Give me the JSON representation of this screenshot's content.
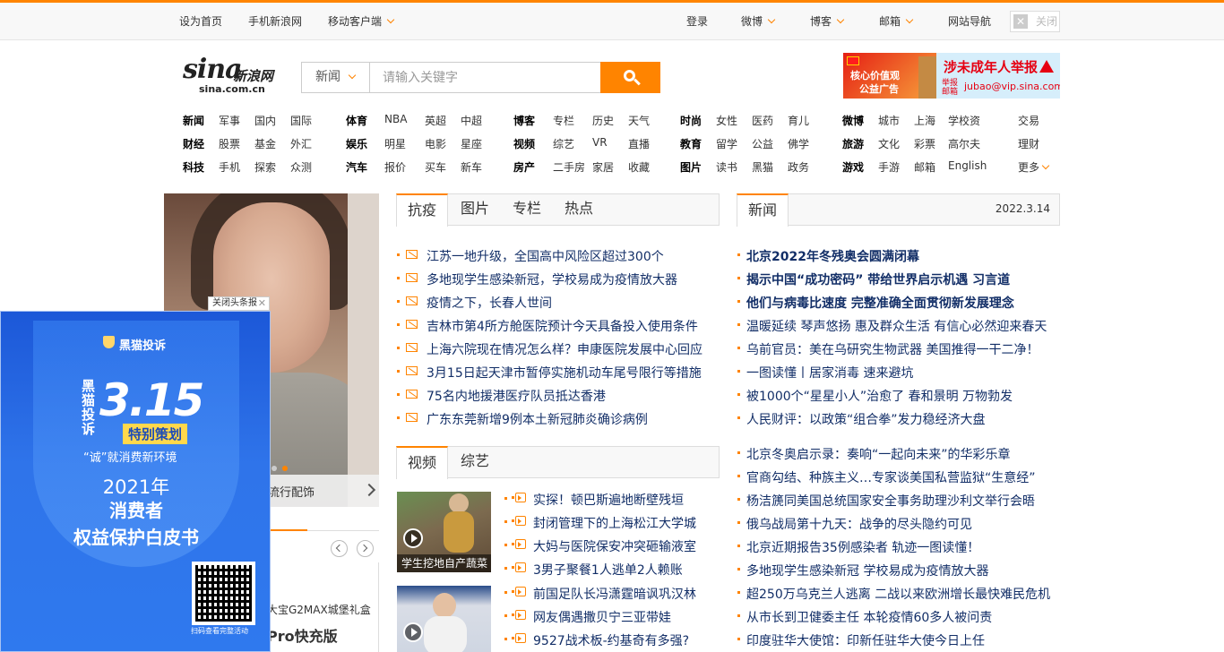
{
  "topbar": {
    "set_home": "设为首页",
    "mobile_sina": "手机新浪网",
    "mobile_client": "移动客户端",
    "login": "登录",
    "weibo": "微博",
    "blog": "博客",
    "mail": "邮箱",
    "site_nav": "网站导航",
    "close": "关闭"
  },
  "logo": {
    "brand": "sina",
    "cn": "新浪网",
    "domain": "sina.com.cn"
  },
  "search": {
    "category": "新闻",
    "placeholder": "请输入关键字"
  },
  "ad_top": {
    "left_line1": "核心价值观",
    "left_line2": "公益广告",
    "headline": "涉未成年人举报",
    "sub": "举报邮箱",
    "email": "jubao@vip.sina.com"
  },
  "nav": {
    "rows": [
      [
        "新闻",
        "军事",
        "国内",
        "国际",
        "体育",
        "NBA",
        "英超",
        "中超",
        "博客",
        "专栏",
        "历史",
        "天气",
        "时尚",
        "女性",
        "医药",
        "育儿",
        "微博",
        "城市",
        "上海",
        "学校资",
        "交易"
      ],
      [
        "财经",
        "股票",
        "基金",
        "外汇",
        "娱乐",
        "明星",
        "电影",
        "星座",
        "视频",
        "综艺",
        "VR",
        "直播",
        "教育",
        "留学",
        "公益",
        "佛学",
        "旅游",
        "文化",
        "彩票",
        "高尔夫",
        "理财"
      ],
      [
        "科技",
        "手机",
        "探索",
        "众测",
        "汽车",
        "报价",
        "买车",
        "新车",
        "房产",
        "二手房",
        "家居",
        "收藏",
        "图片",
        "读书",
        "黑猫",
        "政务",
        "游戏",
        "手游",
        "邮箱",
        "English",
        "更多"
      ]
    ]
  },
  "slide": {
    "caption": "流行配饰"
  },
  "float_ad": {
    "close_label": "关闭头条报",
    "brand": "黑猫投诉",
    "vertical": "黑猫投诉",
    "big": "3.15",
    "special": "特别策划",
    "sub": "“诚”就消费新环境",
    "year": "2021年",
    "line2": "消费者",
    "line3": "权益保护白皮书",
    "qr_caption": "扫码查看完整活动"
  },
  "module2": {
    "text1": "大宝G2MAX城堡礼盒",
    "text2": "Pro快充版"
  },
  "tabs_left": [
    "抗疫",
    "图片",
    "专栏",
    "热点"
  ],
  "epidemic_news": [
    "江苏一地升级，全国高中风险区超过300个",
    "多地现学生感染新冠，学校易成为疫情放大器",
    "疫情之下，长春人世间",
    "吉林市第4所方舱医院预计今天具备投入使用条件",
    "上海六院现在情况怎么样？申康医院发展中心回应",
    "3月15日起天津市暂停实施机动车尾号限行等措施",
    "75名内地援港医疗队员抵达香港",
    "广东东莞新增9例本土新冠肺炎确诊病例"
  ],
  "tabs_video": [
    "视频",
    "综艺"
  ],
  "video_thumb_caption": "学生挖地自产蔬菜",
  "video_news": [
    "实探！顿巴斯遍地断壁残垣",
    "封闭管理下的上海松江大学城",
    "大妈与医院保安冲突砸输液室",
    "3男子聚餐1人逃单2人赖账",
    "前国足队长冯潇霆暗讽巩汉林",
    "网友偶遇撒贝宁三亚带娃",
    "9527战术板-约基奇有多强?"
  ],
  "tabs_news": [
    "新闻"
  ],
  "date": "2022.3.14",
  "headline_news": [
    "北京2022年冬残奥会圆满闭幕",
    "揭示中国“成功密码” 带给世界启示机遇 习言道",
    "他们与病毒比速度 完整准确全面贯彻新发展理念"
  ],
  "news_group1": [
    "温暖延续 琴声悠扬 惠及群众生活 有信心必然迎来春天",
    "乌前官员：美在乌研究生物武器 美国推得一干二净！",
    "一图读懂丨居家消毒 速来避坑",
    "被1000个“星星小人”治愈了 春和景明 万物勃发",
    "人民财评：以政策“组合拳”发力稳经济大盘"
  ],
  "news_group2": [
    "北京冬奥启示录：奏响“一起向未来”的华彩乐章",
    "官商勾结、种族主义…专家谈美国私营监狱“生意经”",
    "杨洁篪同美国总统国家安全事务助理沙利文举行会晤",
    "俄乌战局第十九天：战争的尽头隐约可见",
    "北京近期报告35例感染者 轨迹一图读懂！",
    "多地现学生感染新冠 学校易成为疫情放大器",
    "超250万乌克兰人逃离 二战以来欧洲增长最快难民危机",
    "从市长到卫健委主任 本轮疫情60多人被问责",
    "印度驻华大使馆：印新任驻华大使今日上任"
  ]
}
